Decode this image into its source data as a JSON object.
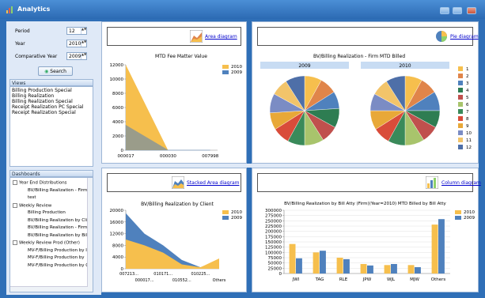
{
  "window": {
    "title": "Analytics"
  },
  "filters": {
    "period_label": "Period",
    "period_value": "12",
    "year_label": "Year",
    "year_value": "2010",
    "comp_year_label": "Comparative Year",
    "comp_year_value": "2009",
    "search_label": "Search"
  },
  "views": {
    "header": "Views",
    "items": [
      "Billing Production Special",
      "Billing Realization",
      "Billing Realization Special",
      "Receipt Realization PC Special",
      "Receipt Realization Special"
    ]
  },
  "dashboards": {
    "header": "Dashboards",
    "items": [
      {
        "text": "Year End Distributions",
        "level": 0
      },
      {
        "text": "BV/Billing Realization - Firm",
        "level": 1
      },
      {
        "text": "test",
        "level": 1
      },
      {
        "text": "Weekly Review",
        "level": 0
      },
      {
        "text": "Billing Production",
        "level": 1
      },
      {
        "text": "BV/Billing Realization by Cli",
        "level": 1
      },
      {
        "text": "BV/Billing Realization - Firm",
        "level": 1
      },
      {
        "text": "BV/Billing Realization by Bill",
        "level": 1
      },
      {
        "text": "Weekly Review Prod (Other)",
        "level": 0
      },
      {
        "text": "MV-F/Billing Production by I",
        "level": 1
      },
      {
        "text": "MV-F/Billing Production by",
        "level": 1
      },
      {
        "text": "MV-F/Billing Production by C",
        "level": 1
      }
    ]
  },
  "panels": {
    "area": {
      "link": "Area diagram",
      "title": "MTD Fee Matter Value"
    },
    "pie": {
      "link": "Pie diagram",
      "title": "BV/Billing Realization - Firm  MTD Billed",
      "tab1": "2009",
      "tab2": "2010"
    },
    "stacked": {
      "link": "Stacked Area diagram",
      "title": "BV/Billing Realization by Client"
    },
    "column": {
      "link": "Column diagram",
      "title": "BV/Billing Realization by Bill Atty (Firm)(Year=2010)  MTD Billed by Bill Atty"
    }
  },
  "chart_data": [
    {
      "type": "area",
      "title": "MTD Fee Matter Value",
      "categories": [
        "000017",
        "000030",
        "007998"
      ],
      "ylim": [
        0,
        12000
      ],
      "yticks": [
        0,
        2000,
        4000,
        6000,
        8000,
        10000,
        12000
      ],
      "series": [
        {
          "name": "2010",
          "values": [
            12000,
            0,
            0
          ]
        },
        {
          "name": "2009",
          "values": [
            3500,
            0,
            0
          ]
        }
      ],
      "colors": [
        "#f6bf4d",
        "#4f81bd"
      ],
      "legend": "right"
    },
    {
      "type": "pie",
      "title": "BV/Billing Realization - Firm  MTD Billed",
      "labels": [
        "1",
        "2",
        "3",
        "4",
        "5",
        "6",
        "7",
        "8",
        "9",
        "10",
        "11",
        "12"
      ],
      "series": [
        {
          "name": "2009",
          "values": [
            8,
            8,
            8,
            9,
            8,
            9,
            8,
            8,
            8,
            9,
            8,
            9
          ]
        },
        {
          "name": "2010",
          "values": [
            8,
            8,
            9,
            8,
            8,
            9,
            8,
            8,
            9,
            8,
            8,
            9
          ]
        }
      ],
      "colors": [
        "#f6bf4d",
        "#e0854a",
        "#4f81bd",
        "#2e7d52",
        "#c0504d",
        "#a8c46c",
        "#3a8a5a",
        "#d94c3a",
        "#e8a838",
        "#7b8cc4",
        "#f2c46a",
        "#4e6fa8"
      ],
      "legend": "right"
    },
    {
      "type": "area",
      "title": "BV/Billing Realization by Client",
      "categories": [
        "007213...",
        "000017...",
        "010171...",
        "010552...",
        "010225...",
        "Others"
      ],
      "ylim": [
        0,
        20000
      ],
      "yticks": [
        0,
        4000,
        8000,
        12000,
        16000,
        20000
      ],
      "series": [
        {
          "name": "2010",
          "values": [
            10000,
            8000,
            5500,
            1500,
            500,
            3500
          ]
        },
        {
          "name": "2009",
          "values": [
            19000,
            12000,
            8000,
            3000,
            500,
            3000
          ]
        }
      ],
      "colors": [
        "#f6bf4d",
        "#4f81bd"
      ],
      "legend": "right"
    },
    {
      "type": "bar",
      "title": "BV/Billing Realization by Bill Atty (Firm)(Year=2010)  MTD Billed by Bill Atty",
      "categories": [
        "JWI",
        "TAG",
        "RLE",
        "JPW",
        "WJL",
        "MJW",
        "Others"
      ],
      "ylim": [
        0,
        300000
      ],
      "yticks": [
        0,
        25000,
        50000,
        75000,
        100000,
        125000,
        150000,
        175000,
        200000,
        225000,
        250000,
        275000,
        300000
      ],
      "series": [
        {
          "name": "2010",
          "values": [
            140000,
            100000,
            75000,
            45000,
            40000,
            40000,
            232000
          ]
        },
        {
          "name": "2009",
          "values": [
            72000,
            108000,
            68000,
            38000,
            45000,
            30000,
            258000
          ]
        }
      ],
      "colors": [
        "#f6bf4d",
        "#4f81bd"
      ],
      "legend": "right"
    }
  ]
}
